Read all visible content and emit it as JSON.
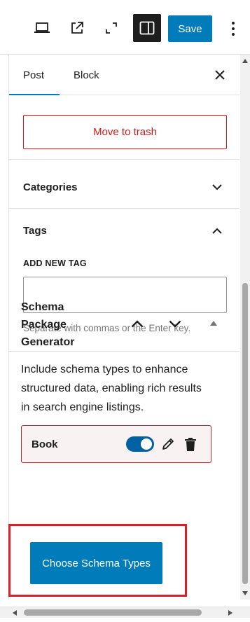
{
  "toolbar": {
    "view_icon": "laptop-icon",
    "preview_icon": "external-link-icon",
    "fullscreen_icon": "fullscreen-icon",
    "sidebar_icon": "sidebar-icon",
    "save_label": "Save",
    "more_icon": "more-vertical-icon"
  },
  "sidebar": {
    "tabs": [
      {
        "label": "Post",
        "active": true
      },
      {
        "label": "Block",
        "active": false
      }
    ],
    "close_icon": "close-icon",
    "trash_label": "Move to trash",
    "categories_label": "Categories",
    "tags": {
      "title": "Tags",
      "add_label": "ADD NEW TAG",
      "input_value": "",
      "help": "Separate with commas or the Enter key."
    },
    "schema": {
      "title": "Schema Package Generator",
      "description": "Include schema types to enhance structured data, enabling rich results in search engine listings.",
      "items": [
        {
          "label": "Book",
          "enabled": true
        }
      ],
      "choose_button": "Choose Schema Types"
    }
  },
  "colors": {
    "accent": "#007cba",
    "danger": "#cc1818",
    "highlight": "#d9202a",
    "toggle_on": "#0062a3"
  }
}
